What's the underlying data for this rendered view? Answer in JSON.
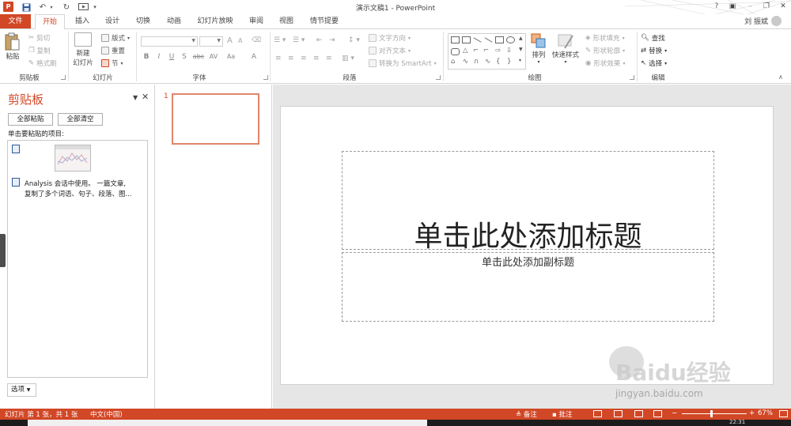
{
  "window": {
    "title": "演示文稿1 - PowerPoint",
    "user": "刘 振斌"
  },
  "tabs": [
    "文件",
    "开始",
    "插入",
    "设计",
    "切换",
    "动画",
    "幻灯片放映",
    "审阅",
    "视图",
    "情节提要"
  ],
  "ribbon": {
    "clipboard": {
      "paste": "粘贴",
      "cut": "剪切",
      "copy": "复制",
      "format_painter": "格式刷",
      "label": "剪贴板"
    },
    "slides": {
      "new_slide_l1": "新建",
      "new_slide_l2": "幻灯片",
      "layout": "版式",
      "reset": "重置",
      "section": "节",
      "label": "幻灯片"
    },
    "font": {
      "font_size_up": "A",
      "font_size_down": "A",
      "clear": "⌫",
      "bold": "B",
      "italic": "I",
      "underline": "U",
      "shadow": "S",
      "strike": "abc",
      "spacing": "AV",
      "case": "Aa",
      "color": "A",
      "label": "字体"
    },
    "paragraph": {
      "text_direction": "文字方向",
      "align_text": "对齐文本",
      "smartart": "转换为 SmartArt",
      "label": "段落"
    },
    "drawing": {
      "arrange": "排列",
      "quick_styles": "快速样式",
      "shape_fill": "形状填充",
      "shape_outline": "形状轮廓",
      "shape_effects": "形状效果",
      "label": "绘图"
    },
    "editing": {
      "find": "查找",
      "replace": "替换",
      "select": "选择",
      "label": "编辑"
    }
  },
  "clipboard_pane": {
    "title": "剪贴板",
    "paste_all": "全部粘贴",
    "clear_all": "全部清空",
    "instruction": "单击要粘贴的项目:",
    "item_text_line1": "Analysis 会话中使用。 一篇文章,",
    "item_text_line2": "复制了多个词语、句子、段落、图...",
    "options": "选项"
  },
  "thumbnails": {
    "slide_number": "1"
  },
  "slide": {
    "title_placeholder": "单击此处添加标题",
    "subtitle_placeholder": "单击此处添加副标题"
  },
  "statusbar": {
    "slide_info": "幻灯片 第 1 张，共 1 张",
    "language": "中文(中国)",
    "notes": "备注",
    "comments": "批注",
    "zoom": "67%",
    "zoom_level_percent": 67
  },
  "taskbar": {
    "clock": "22:31"
  },
  "watermark": {
    "logo": "Baidu经验",
    "url": "jingyan.baidu.com"
  },
  "colors": {
    "accent": "#d24726",
    "statusbar": "#d24726",
    "editor_bg": "#e6e6e6"
  }
}
